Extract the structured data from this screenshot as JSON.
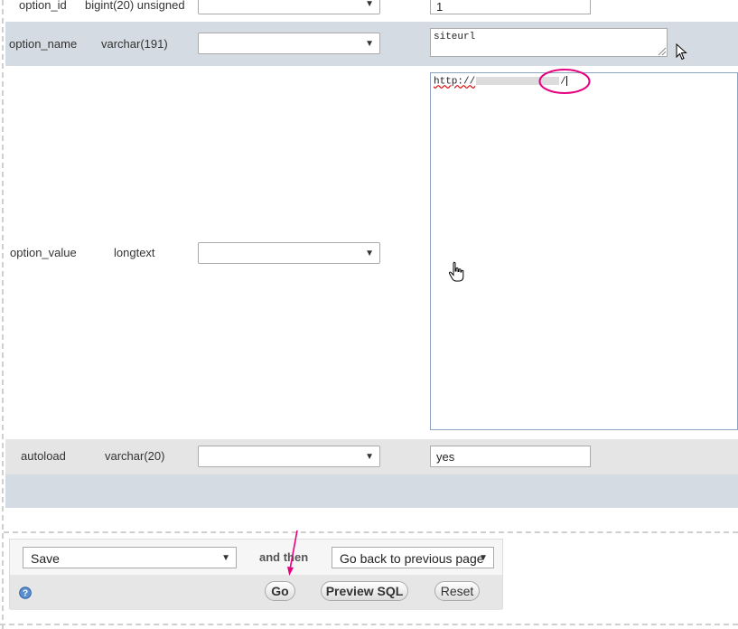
{
  "rows": [
    {
      "name": "option_id",
      "type": "bigint(20) unsigned",
      "value": "1"
    },
    {
      "name": "option_name",
      "type": "varchar(191)",
      "value": "siteurl"
    },
    {
      "name": "option_value",
      "type": "longtext",
      "value_prefix": "http://",
      "value_suffix": "/"
    },
    {
      "name": "autoload",
      "type": "varchar(20)",
      "value": "yes"
    }
  ],
  "footer": {
    "action_select": "Save",
    "and_then": "and then",
    "after_select": "Go back to previous page",
    "go": "Go",
    "preview_sql": "Preview SQL",
    "reset": "Reset"
  },
  "annotation_color": "#e6007e"
}
